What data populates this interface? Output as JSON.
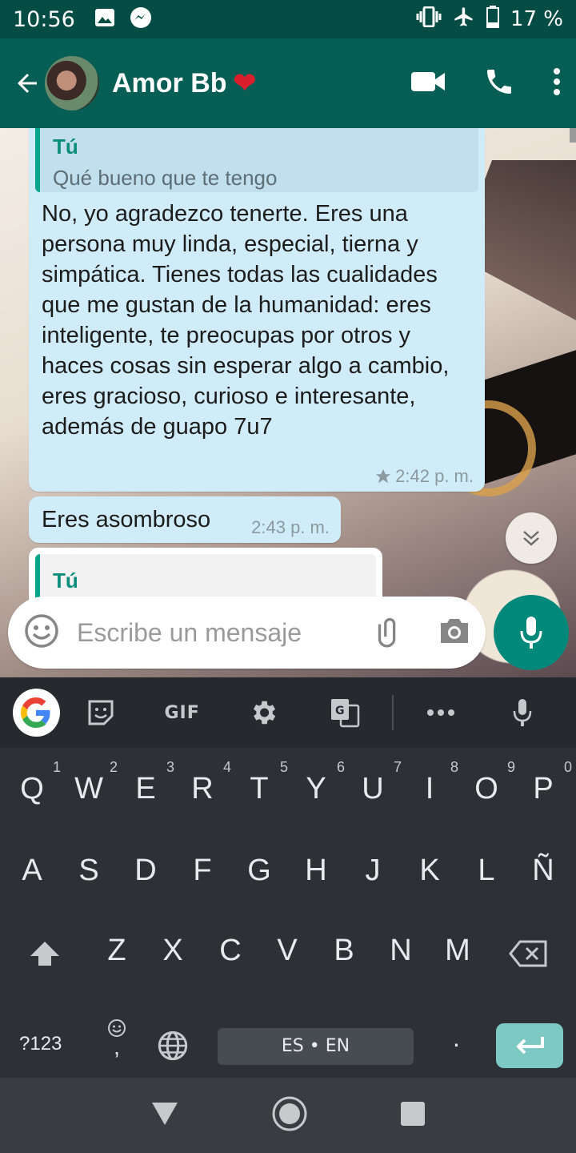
{
  "status_bar": {
    "time": "10:56",
    "battery": "17 %"
  },
  "app_bar": {
    "contact_name": "Amor Bb",
    "heart_emoji": "❤"
  },
  "messages": [
    {
      "quote_author": "Tú",
      "quote_text": "Qué bueno que te tengo",
      "text": "No, yo agradezco tenerte. Eres una persona muy linda, especial, tierna y simpática. Tienes todas las cualidades que me gustan de la humanidad: eres inteligente, te preocupas por otros y haces cosas sin esperar algo a cambio, eres gracioso, curioso e interesante, además de guapo 7u7",
      "time": "2:42 p. m.",
      "starred": true
    },
    {
      "text": "Eres asombroso",
      "time": "2:43 p. m."
    },
    {
      "quote_author": "Tú"
    }
  ],
  "input": {
    "placeholder": "Escribe un mensaje"
  },
  "keyboard": {
    "toolbar": {
      "gif_label": "GIF"
    },
    "row1": [
      {
        "k": "Q",
        "n": "1"
      },
      {
        "k": "W",
        "n": "2"
      },
      {
        "k": "E",
        "n": "3"
      },
      {
        "k": "R",
        "n": "4"
      },
      {
        "k": "T",
        "n": "5"
      },
      {
        "k": "Y",
        "n": "6"
      },
      {
        "k": "U",
        "n": "7"
      },
      {
        "k": "I",
        "n": "8"
      },
      {
        "k": "O",
        "n": "9"
      },
      {
        "k": "P",
        "n": "0"
      }
    ],
    "row2": [
      "A",
      "S",
      "D",
      "F",
      "G",
      "H",
      "J",
      "K",
      "L",
      "Ñ"
    ],
    "row3": [
      "Z",
      "X",
      "C",
      "V",
      "B",
      "N",
      "M"
    ],
    "symbols_label": "?123",
    "space_label": "ES • EN",
    "period_label": ".",
    "comma_label": ","
  },
  "colors": {
    "header": "#075E54",
    "accent": "#00897B",
    "bubble_out": "#d1ecf9"
  }
}
